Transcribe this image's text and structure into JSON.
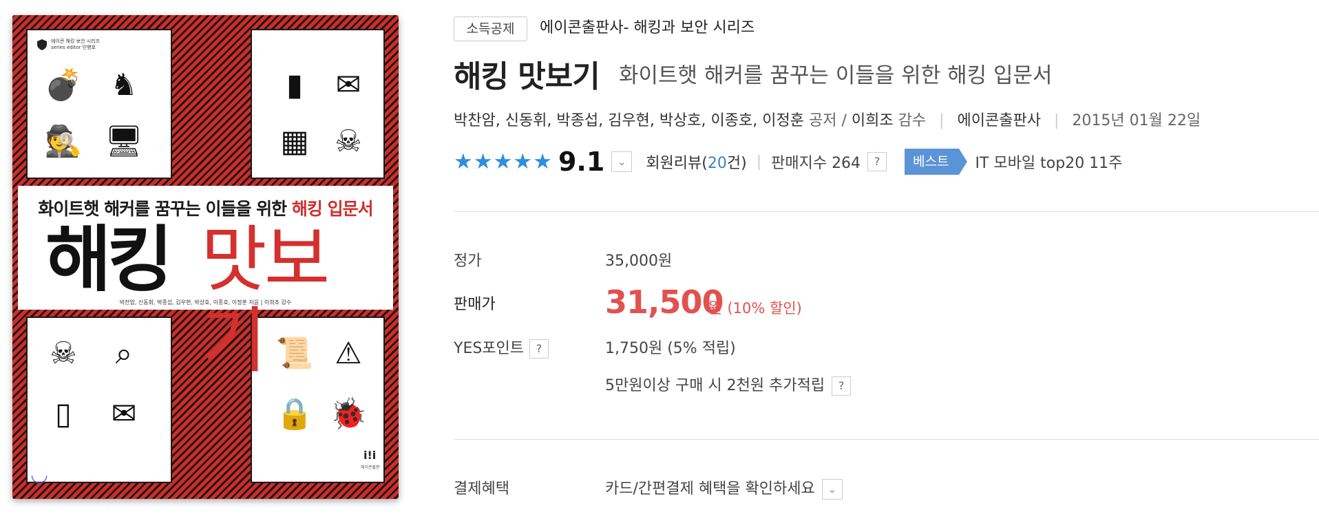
{
  "cover": {
    "series_line1": "에이콘 해킹 보안 시리즈",
    "series_line2": "series editor 민병호",
    "subtitle_plain": "화이트햇 해커를 꿈꾸는 이들을 위한",
    "subtitle_highlight": "해킹 입문서",
    "title_black": "해킹",
    "title_red": "맛보기",
    "authors": "박찬암, 신동휘, 박종섭, 김우현, 박상호, 이종호, 이정훈 지음 | 이희조 감수",
    "publisher_mark": "i!i",
    "publisher_sub": "에이콘출판",
    "icons": [
      "bomb-icon",
      "trojan-horse-icon",
      "spy-icon",
      "computer-icon",
      "usb-icon",
      "mail-virus-icon",
      "firewall-icon",
      "skull-icon",
      "pirate-icon",
      "binary-search-icon",
      "script-icon",
      "monitor-alert-icon",
      "flash-drive-icon",
      "spam-icon",
      "lock-icon",
      "bug-icon"
    ]
  },
  "product": {
    "badge": "소득공제",
    "series": "에이콘출판사- 해킹과 보안 시리즈",
    "title": "해킹 맛보기",
    "subtitle": "화이트햇 해커를 꿈꾸는 이들을 위한 해킹 입문서",
    "authors": "박찬암, 신동휘, 박종섭, 김우현, 박상호, 이종호, 이정훈",
    "authors_role": "공저",
    "slash": "/",
    "supervisor": "이희조",
    "supervisor_role": "감수",
    "publisher": "에이콘출판사",
    "date": "2015년 01월 22일",
    "rating": "9.1",
    "stars": 5,
    "review_label": "회원리뷰(",
    "review_count": "20",
    "review_suffix": "건)",
    "sales_label": "판매지수 264",
    "best_badge": "베스트",
    "rank_text": "IT 모바일 top20 11주"
  },
  "pricing": {
    "list_label": "정가",
    "list_price": "35,000원",
    "sale_label": "판매가",
    "sale_price": "31,500",
    "sale_unit": "원",
    "discount": "(10% 할인)",
    "points_label": "YES포인트",
    "points_value": "1,750원 (5% 적립)",
    "bonus_text": "5만원이상 구매 시 2천원 추가적립",
    "payment_label": "결제혜택",
    "payment_text": "카드/간편결제 혜택을 확인하세요"
  },
  "help_mark": "?",
  "chevron": "⌄",
  "colors": {
    "accent_price": "#e2514e",
    "star_blue": "#2e8ee0",
    "best_badge": "#5b94d6",
    "cover_red": "#c9302c"
  }
}
